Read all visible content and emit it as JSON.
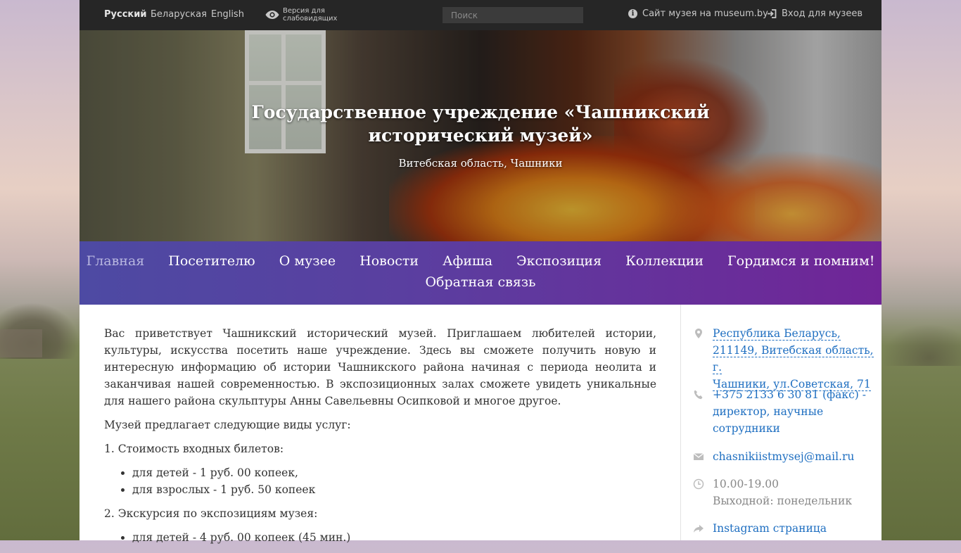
{
  "topbar": {
    "languages": [
      "Русский",
      "Беларуская",
      "English"
    ],
    "vision_label": [
      "Версия для",
      "слабовидящих"
    ],
    "search_placeholder": "Поиск",
    "museum_site_label": "Сайт музея на museum.by",
    "login_label": "Вход для музеев"
  },
  "hero": {
    "title_line1": "Государственное учреждение «Чашникский",
    "title_line2": "исторический музей»",
    "subtitle": "Витебская область, Чашники"
  },
  "nav": {
    "items": [
      "Главная",
      "Посетителю",
      "О музее",
      "Новости",
      "Афиша",
      "Экспозиция",
      "Коллекции",
      "Гордимся и помним!",
      "Обратная связь"
    ],
    "active_index": 0
  },
  "content": {
    "intro": "Вас приветствует Чашникский исторический музей. Приглашаем любителей истории, культуры, искусства посетить наше учреждение. Здесь вы сможете получить новую и интересную информацию об истории Чашникского района начиная с периода неолита и заканчивая нашей современностью. В экспозиционных залах сможете увидеть уникальные для нашего района скульптуры Анны Савельевны Осипковой и многое другое.",
    "services_heading": "Музей предлагает следующие виды услуг:",
    "section1_heading": "1. Стоимость входных билетов:",
    "section1_items": [
      "для детей - 1 руб. 00 копеек,",
      "для взрослых - 1 руб. 50 копеек"
    ],
    "section2_heading": "2. Экскурсия по экспозициям музея:",
    "section2_items": [
      "для детей - 4 руб. 00 копеек (45 мин.)"
    ]
  },
  "sidebar": {
    "address": "Республика Беларусь, 211149, Витебская область, г. Чашники, ул.Советская, 71",
    "address_lines": [
      "Республика Беларусь,",
      "211149, Витебская область, г.",
      "Чашники, ул.Советская, 71"
    ],
    "phone": "+375 2133 6 30 81 (факс)",
    "phone_note": " - директор, научные сотрудники",
    "phone_lines": [
      "+375 2133 6 30 81 (факс) -",
      "директор, научные",
      "сотрудники"
    ],
    "email": "chasnikiistmysej@mail.ru",
    "hours": "10.00-19.00",
    "day_off": "Выходной: понедельник",
    "instagram": "Instagram страница"
  },
  "icons": {
    "eye": "eye-icon",
    "info": "info-icon",
    "login": "login-icon",
    "location": "map-marker-icon",
    "phone": "phone-icon",
    "email": "envelope-icon",
    "clock": "clock-icon",
    "share": "share-arrow-icon"
  },
  "colors": {
    "topbar_bg": "#262626",
    "nav_gradient_start": "#4d4aa3",
    "nav_gradient_end": "#702597",
    "link": "#1f6fc1",
    "nav_active": "#b8b7e0"
  }
}
